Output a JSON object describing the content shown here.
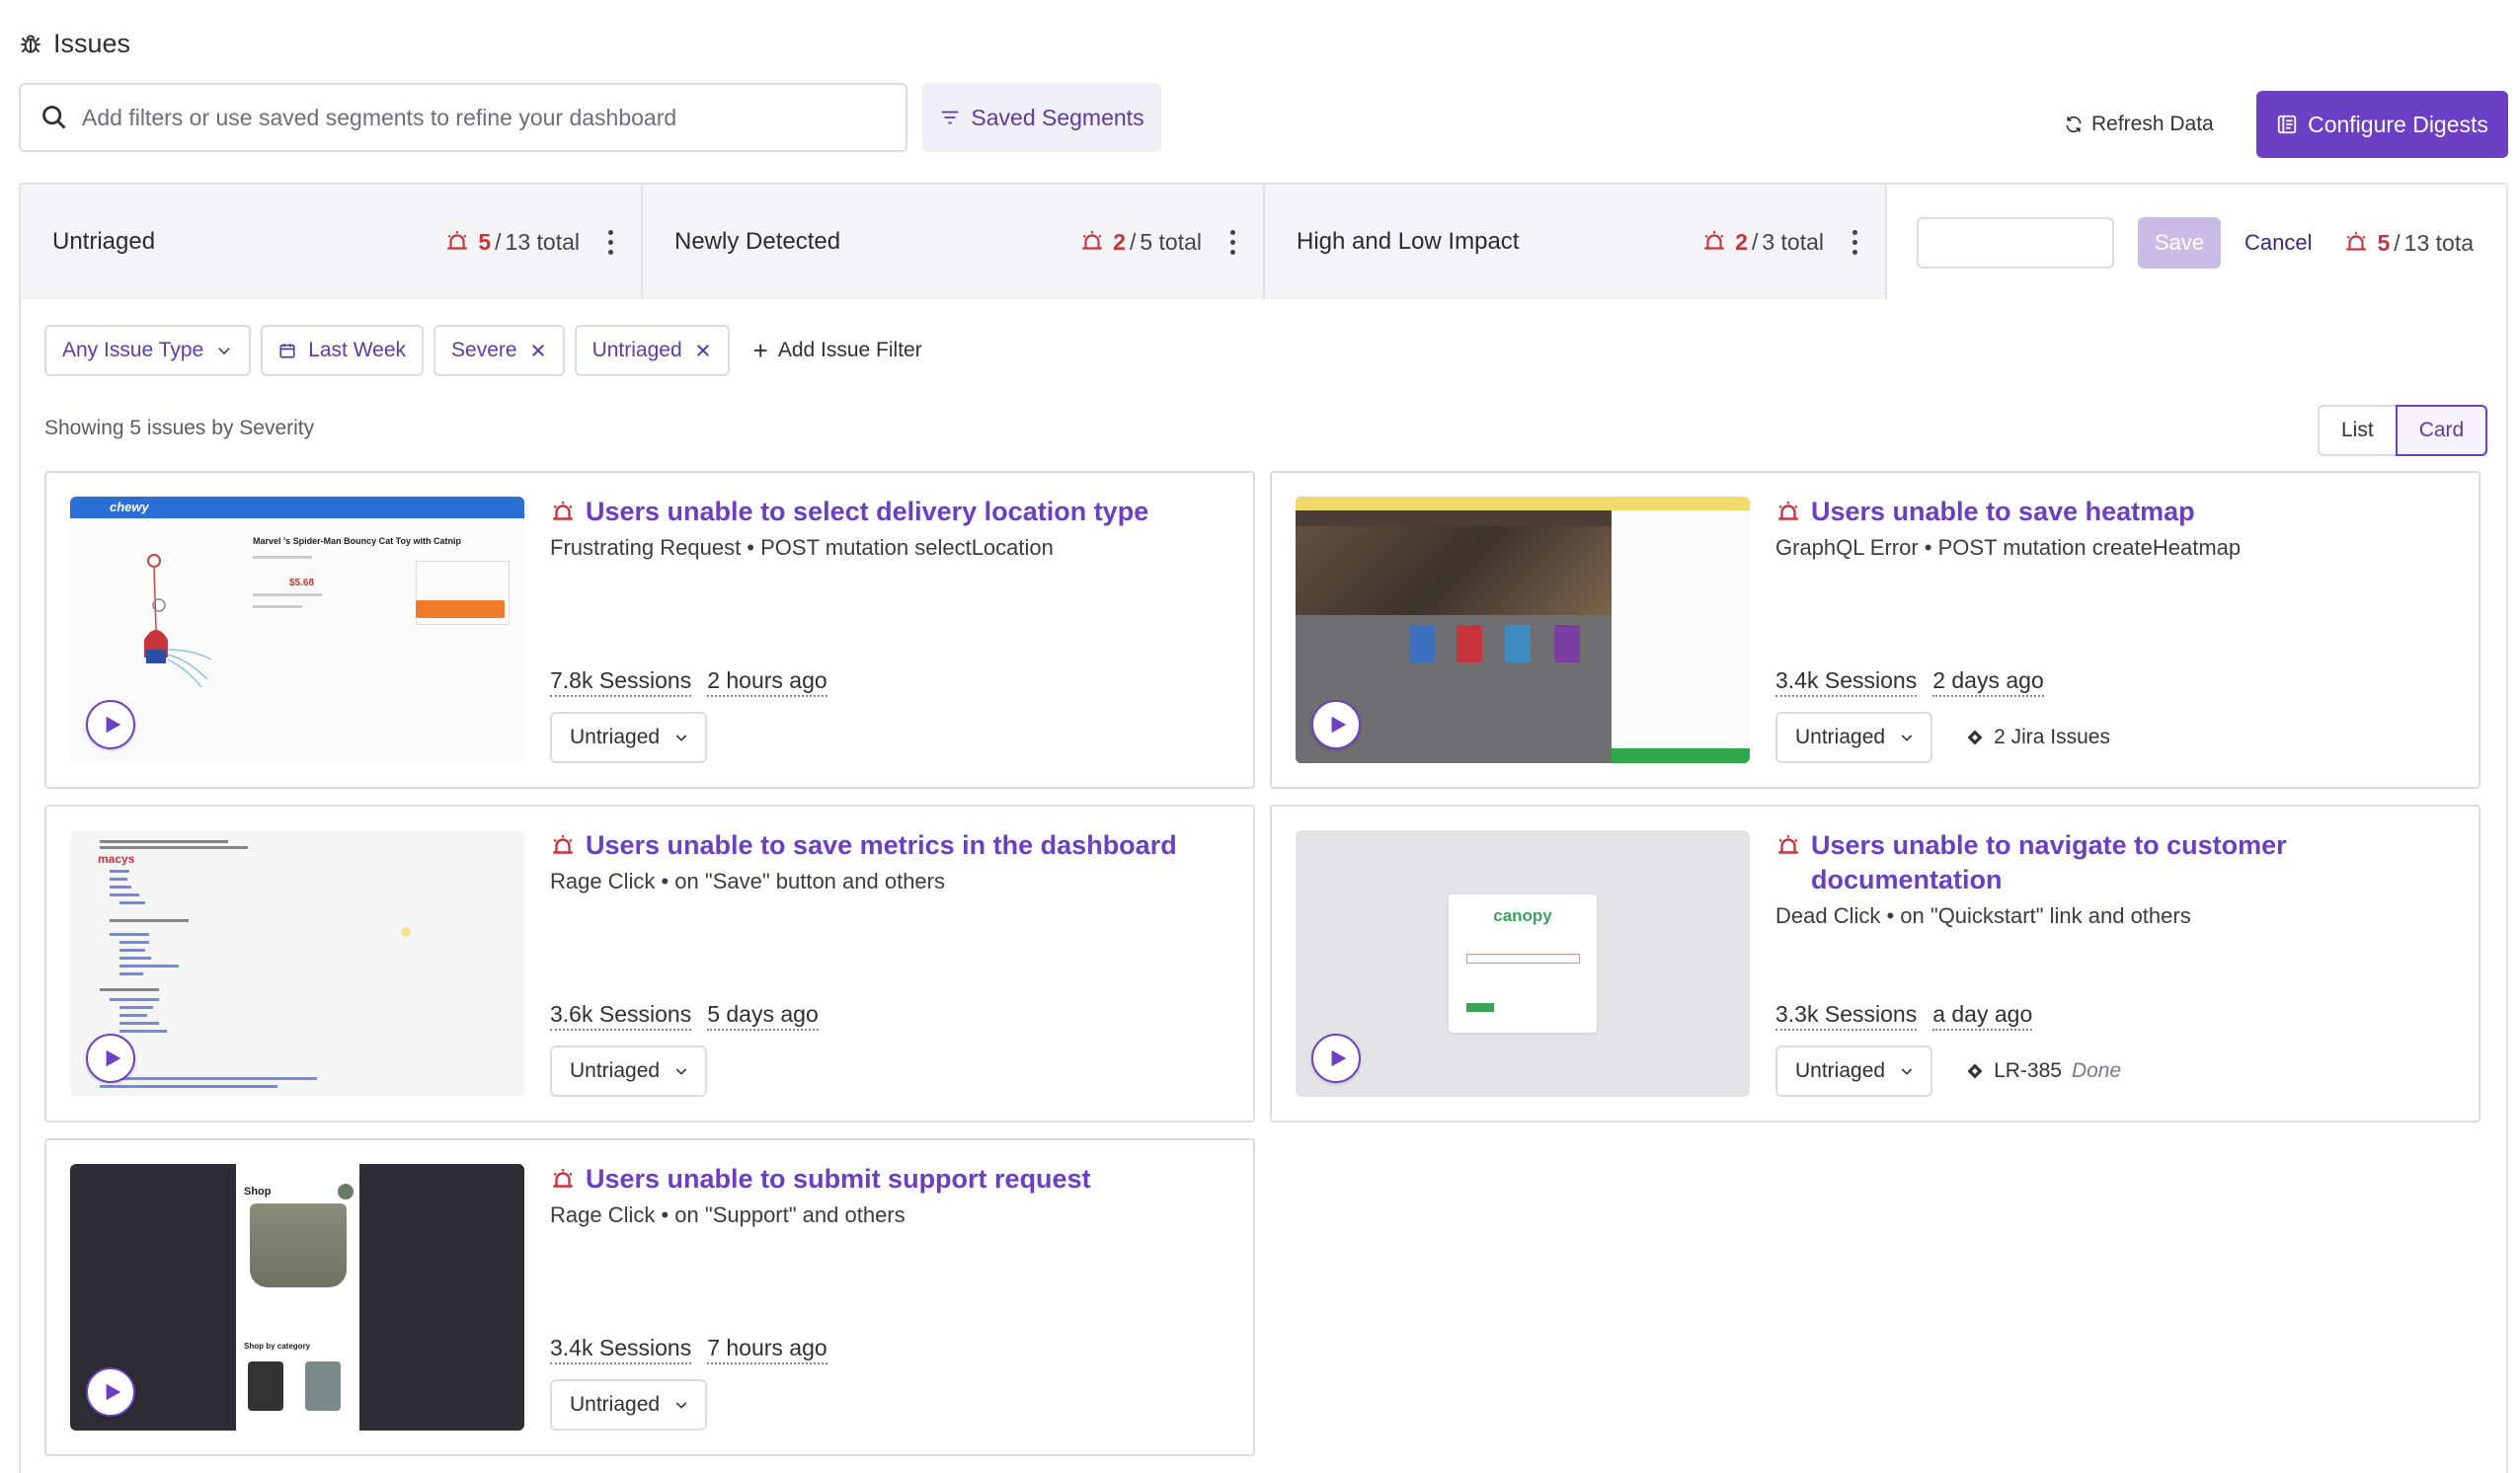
{
  "header": {
    "title": "Issues",
    "search_placeholder": "Add filters or use saved segments to refine your dashboard",
    "saved_segments_label": "Saved Segments",
    "refresh_label": "Refresh Data",
    "configure_label": "Configure Digests"
  },
  "segments": [
    {
      "name": "Untriaged",
      "count": "5",
      "total": "13 total"
    },
    {
      "name": "Newly Detected",
      "count": "2",
      "total": "5 total"
    },
    {
      "name": "High and Low Impact",
      "count": "2",
      "total": "3 total"
    }
  ],
  "segment_edit": {
    "input_value": "",
    "save_label": "Save",
    "cancel_label": "Cancel",
    "count": "5",
    "total": "13 tota"
  },
  "filters": {
    "issue_type": "Any Issue Type",
    "date_range": "Last Week",
    "severity": "Severe",
    "status": "Untriaged",
    "add_filter_label": "Add Issue Filter"
  },
  "summary_text": "Showing 5 issues by Severity",
  "view_toggle": {
    "list_label": "List",
    "card_label": "Card",
    "selected": "Card"
  },
  "issues": [
    {
      "title": "Users unable to select delivery location type",
      "subtitle": "Frustrating Request • POST mutation selectLocation",
      "sessions": "7.8k Sessions",
      "time": "2 hours ago",
      "status": "Untriaged",
      "link": "",
      "link_state": "",
      "thumb": {
        "product_title": "Marvel 's Spider-Man Bouncy Cat Toy with Catnip",
        "price": "$5.68",
        "logo": "chewy"
      }
    },
    {
      "title": "Users unable to save heatmap",
      "subtitle": "GraphQL Error • POST mutation createHeatmap",
      "sessions": "3.4k Sessions",
      "time": "2 days ago",
      "status": "Untriaged",
      "link": "2 Jira Issues",
      "link_state": ""
    },
    {
      "title": "Users unable to save metrics in the dashboard",
      "subtitle": "Rage Click • on \"Save\" button and others",
      "sessions": "3.6k Sessions",
      "time": "5 days ago",
      "status": "Untriaged",
      "link": "",
      "link_state": "",
      "thumb": {
        "logo": "macys"
      }
    },
    {
      "title": "Users unable to navigate to customer documentation",
      "subtitle": "Dead Click • on \"Quickstart\" link and others",
      "sessions": "3.3k Sessions",
      "time": "a day ago",
      "status": "Untriaged",
      "link": "LR-385",
      "link_state": "Done",
      "thumb": {
        "brand": "canopy"
      }
    },
    {
      "title": "Users unable to submit support request",
      "subtitle": "Rage Click • on \"Support\" and others",
      "sessions": "3.4k Sessions",
      "time": "7 hours ago",
      "status": "Untriaged",
      "link": "",
      "link_state": "",
      "thumb": {
        "title": "Shop",
        "category": "Shop by category"
      }
    }
  ],
  "colors": {
    "accent": "#6c3fc5",
    "title_purple": "#6b3ec2",
    "alert_red": "#c8343b",
    "border": "#dcdce0",
    "tab_bg": "#f4f4f6"
  },
  "icons": [
    "bug-icon",
    "search-icon",
    "filter-icon",
    "refresh-icon",
    "digest-icon",
    "alarm-icon",
    "kebab-icon",
    "chevron-down-icon",
    "calendar-icon",
    "close-icon",
    "plus-icon",
    "play-icon",
    "jira-icon"
  ]
}
